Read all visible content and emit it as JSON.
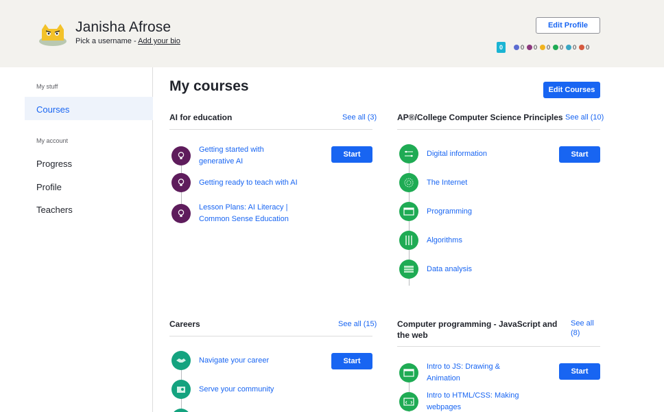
{
  "user": {
    "name": "Janisha Afrose",
    "pick_username": "Pick a username -",
    "add_bio": "Add your bio"
  },
  "header": {
    "edit_profile": "Edit Profile",
    "streak": "0",
    "badge_counts": [
      "0",
      "0",
      "0",
      "0",
      "0",
      "0"
    ],
    "badge_colors": [
      "#5b6cd1",
      "#8c3a7e",
      "#f1b31f",
      "#1fab54",
      "#3aa7c4",
      "#d65a3f"
    ]
  },
  "sidebar": {
    "my_stuff": "My stuff",
    "courses": "Courses",
    "my_account": "My account",
    "progress": "Progress",
    "profile": "Profile",
    "teachers": "Teachers"
  },
  "main": {
    "title": "My courses",
    "edit_courses": "Edit Courses",
    "start": "Start"
  },
  "courses": {
    "ai": {
      "title": "AI for education",
      "see_all": "See all (3)",
      "units": [
        "Getting started with generative AI",
        "Getting ready to teach with AI",
        "Lesson Plans: AI Literacy | Common Sense Education"
      ]
    },
    "ap": {
      "title": "AP®︎/College Computer Science Principles",
      "see_all": "See all (10)",
      "units": [
        "Digital information",
        "The Internet",
        "Programming",
        "Algorithms",
        "Data analysis"
      ]
    },
    "careers": {
      "title": "Careers",
      "see_all": "See all (15)",
      "units": [
        "Navigate your career",
        "Serve your community"
      ]
    },
    "cp": {
      "title": "Computer programming - JavaScript and the web",
      "see_all": "See all (8)",
      "units": [
        "Intro to JS: Drawing & Animation",
        "Intro to HTML/CSS: Making webpages"
      ]
    }
  }
}
